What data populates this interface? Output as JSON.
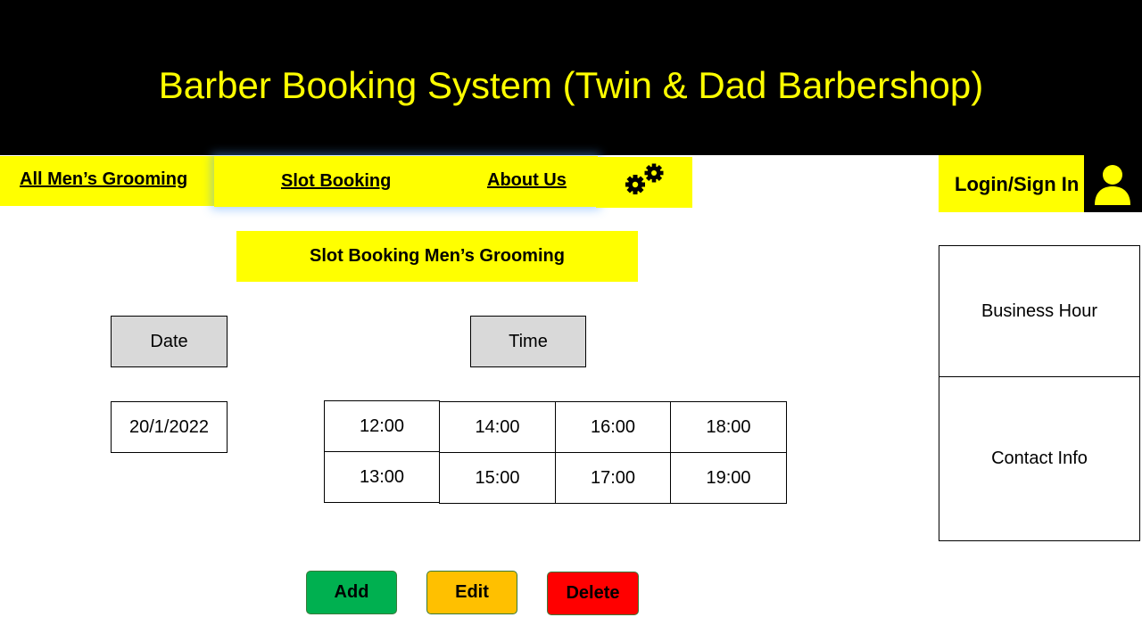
{
  "header": {
    "title": "Barber Booking System (Twin & Dad Barbershop)"
  },
  "nav": {
    "tabs": [
      {
        "label": "All Men’s Grooming"
      },
      {
        "label": "Slot Booking"
      },
      {
        "label": "About Us"
      }
    ],
    "settings_icon": "gear-icon",
    "login_label": "Login/Sign In",
    "user_icon": "user-icon"
  },
  "main": {
    "section_title": "Slot Booking Men’s Grooming",
    "date_label": "Date",
    "time_label": "Time",
    "date_value": "20/1/2022",
    "time_slots": [
      "12:00",
      "13:00",
      "14:00",
      "15:00",
      "16:00",
      "17:00",
      "18:00",
      "19:00"
    ]
  },
  "sidebar": {
    "business_hour": "Business Hour",
    "contact_info": "Contact Info"
  },
  "actions": {
    "add": "Add",
    "edit": "Edit",
    "delete": "Delete"
  },
  "colors": {
    "header_bg": "#000000",
    "accent_yellow": "#ffff00",
    "label_gray": "#d9d9d9",
    "add_green": "#00b050",
    "edit_orange": "#ffc000",
    "delete_red": "#ff0000"
  }
}
